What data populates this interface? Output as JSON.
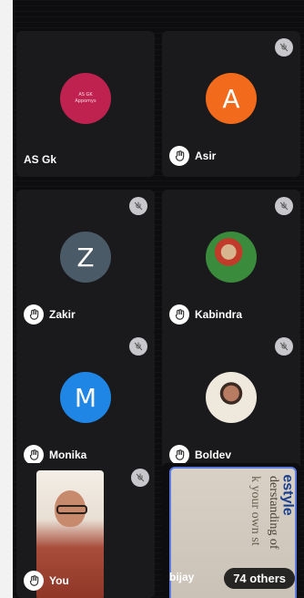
{
  "participants": [
    {
      "name": "AS Gk",
      "avatar_text": "AS GK\nAppomys",
      "avatar_color": "#c0224f",
      "hand": false,
      "muted": false
    },
    {
      "name": "Asir",
      "avatar_text": "A",
      "avatar_color": "#f26a1b",
      "hand": true,
      "muted": true
    },
    {
      "name": "Zakir",
      "avatar_text": "Z",
      "avatar_color": "#4a5a66",
      "hand": true,
      "muted": true
    },
    {
      "name": "Kabindra",
      "avatar_text": "",
      "avatar_color": "",
      "hand": true,
      "muted": true
    },
    {
      "name": "Monika",
      "avatar_text": "M",
      "avatar_color": "#1f86e6",
      "hand": true,
      "muted": true
    },
    {
      "name": "Boldev",
      "avatar_text": "",
      "avatar_color": "",
      "hand": true,
      "muted": true
    },
    {
      "name": "You",
      "avatar_text": "",
      "avatar_color": "",
      "hand": true,
      "muted": true
    },
    {
      "name": "bijay",
      "avatar_text": "",
      "avatar_color": "",
      "hand": false,
      "muted": false
    }
  ],
  "others_count": "74 others",
  "share_brand": "estyle",
  "share_lines": [
    "derstanding of",
    "k your own st"
  ]
}
